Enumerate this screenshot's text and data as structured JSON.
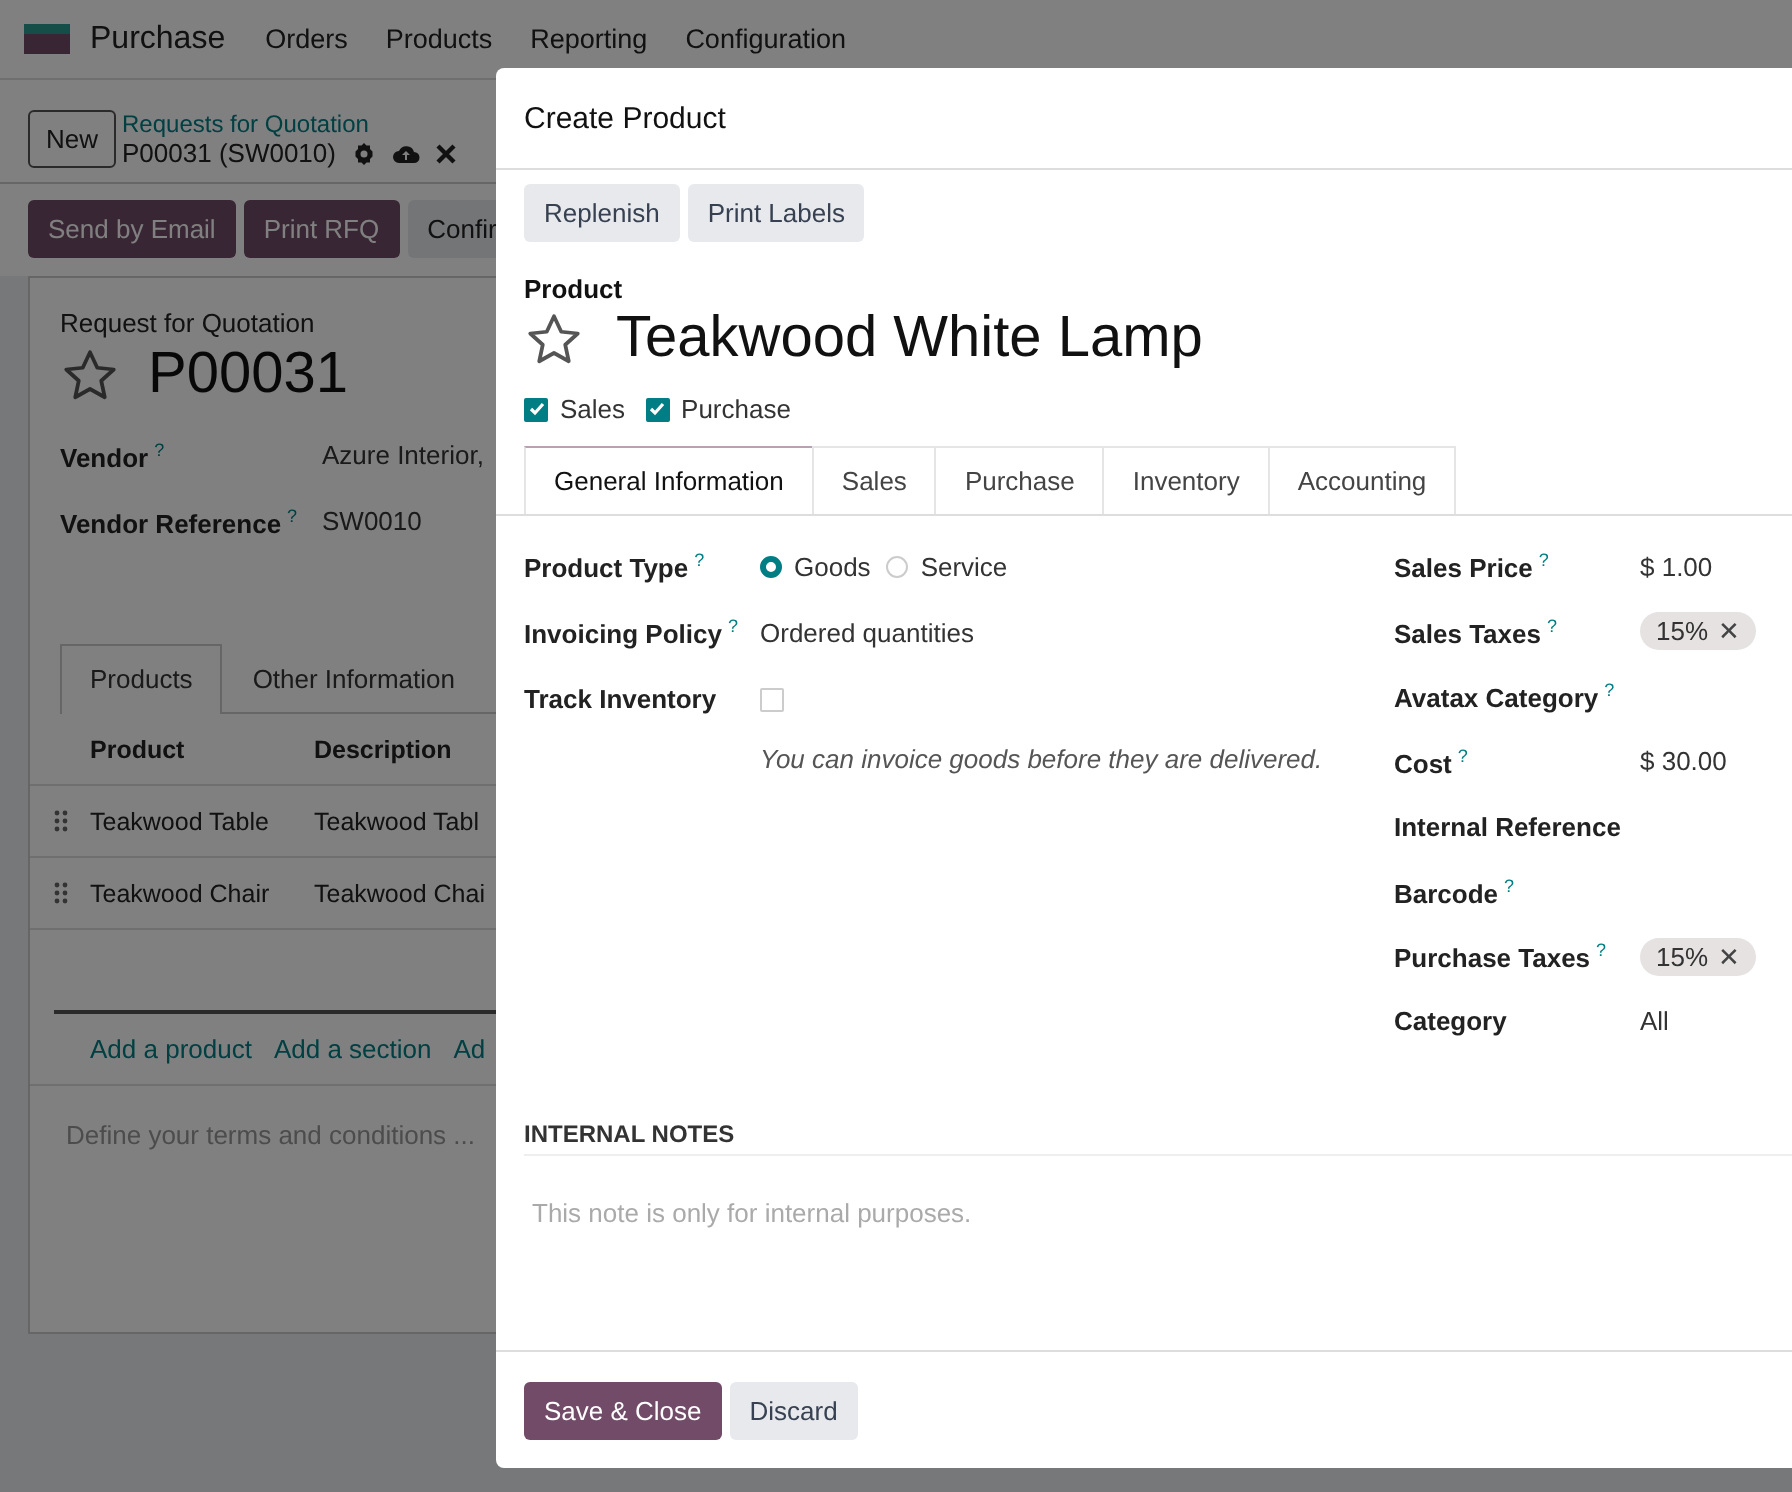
{
  "navbar": {
    "app": "Purchase",
    "menu": [
      "Orders",
      "Products",
      "Reporting",
      "Configuration"
    ]
  },
  "control_panel": {
    "new_button": "New",
    "breadcrumb": "Requests for Quotation",
    "record": "P00031 (SW0010)"
  },
  "actions": [
    {
      "label": "Send by Email",
      "kind": "primary"
    },
    {
      "label": "Print RFQ",
      "kind": "primary"
    },
    {
      "label": "Confir",
      "kind": "secondary"
    }
  ],
  "sheet": {
    "subtitle": "Request for Quotation",
    "name": "P00031",
    "starred": false,
    "fields": [
      {
        "label": "Vendor",
        "help": "?",
        "value": "Azure Interior,"
      },
      {
        "label": "Vendor Reference",
        "help": "?",
        "value": "SW0010"
      }
    ],
    "tabs": [
      {
        "label": "Products",
        "selected": true
      },
      {
        "label": "Other Information",
        "selected": false
      }
    ],
    "table": {
      "columns": [
        "Product",
        "Description"
      ],
      "rows": [
        [
          "Teakwood Table",
          "Teakwood Tabl"
        ],
        [
          "Teakwood Chair",
          "Teakwood Chai"
        ]
      ]
    },
    "add_links": [
      "Add a product",
      "Add a section",
      "Ad"
    ],
    "terms": {
      "placeholder": "Define your terms and conditions ..."
    }
  },
  "dialog": {
    "title": "Create Product",
    "buttons": [
      "Replenish",
      "Print Labels"
    ],
    "name_label": "Product",
    "name": "Teakwood White Lamp",
    "starred": false,
    "flags": [
      {
        "label": "Sales",
        "checked": true
      },
      {
        "label": "Purchase",
        "checked": true
      }
    ],
    "tabs": [
      {
        "label": "General Information",
        "selected": true
      },
      {
        "label": "Sales",
        "selected": false
      },
      {
        "label": "Purchase",
        "selected": false
      },
      {
        "label": "Inventory",
        "selected": false
      },
      {
        "label": "Accounting",
        "selected": false
      }
    ],
    "left_fields": [
      {
        "kind": "radio",
        "label": "Product Type",
        "help": "?",
        "options": [
          {
            "label": "Goods",
            "selected": true
          },
          {
            "label": "Service",
            "selected": false
          }
        ]
      },
      {
        "kind": "text",
        "label": "Invoicing Policy",
        "help": "?",
        "value": "Ordered quantities"
      },
      {
        "kind": "checkbox",
        "label": "Track Inventory",
        "checked": false
      }
    ],
    "note": "You can invoice goods before they are delivered.",
    "right_fields": [
      {
        "kind": "text",
        "label": "Sales Price",
        "help": "?",
        "value": "$ 1.00"
      },
      {
        "kind": "tag",
        "label": "Sales Taxes",
        "help": "?",
        "tags": [
          {
            "label": "15%",
            "remove": "✕"
          }
        ]
      },
      {
        "kind": "empty",
        "label": "Avatax Category",
        "help": "?"
      },
      {
        "kind": "text",
        "label": "Cost",
        "help": "?",
        "value": "$ 30.00"
      },
      {
        "kind": "empty",
        "label": "Internal Reference"
      },
      {
        "kind": "empty",
        "label": "Barcode",
        "help": "?"
      },
      {
        "kind": "tag",
        "label": "Purchase Taxes",
        "help": "?",
        "tags": [
          {
            "label": "15%",
            "remove": "✕"
          }
        ]
      },
      {
        "kind": "text",
        "label": "Category",
        "value": "All"
      }
    ],
    "notes_heading": "INTERNAL NOTES",
    "notes_placeholder": "This note is only for internal purposes.",
    "footer": [
      {
        "label": "Save & Close",
        "kind": "primary"
      },
      {
        "label": "Discard",
        "kind": "secondary"
      }
    ]
  }
}
